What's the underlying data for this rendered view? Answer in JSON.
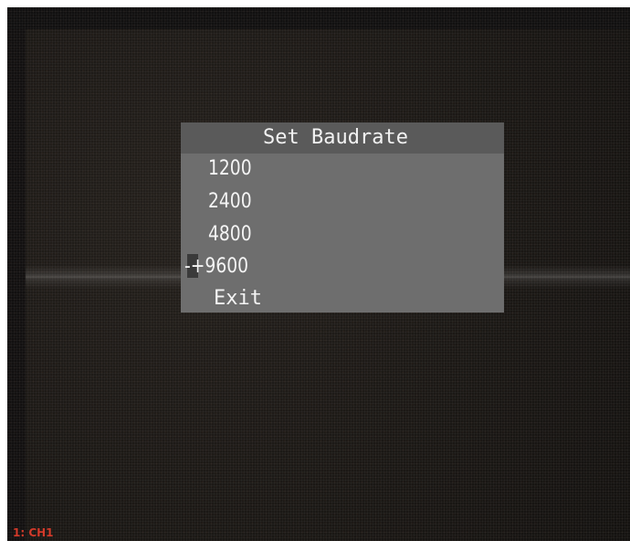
{
  "osd_menu": {
    "title": "Set Baudrate",
    "items": [
      {
        "label": "1200"
      },
      {
        "label": "2400"
      },
      {
        "label": "4800"
      },
      {
        "label": "-+9600",
        "selected": true
      },
      {
        "label": "Exit"
      }
    ],
    "background_color": "#6e6e6e",
    "title_bar_color": "#5a5a5a"
  },
  "channel_label": "1: CH1",
  "colors": {
    "channel_label": "#d23a2a",
    "video_background": "#1b1815"
  }
}
